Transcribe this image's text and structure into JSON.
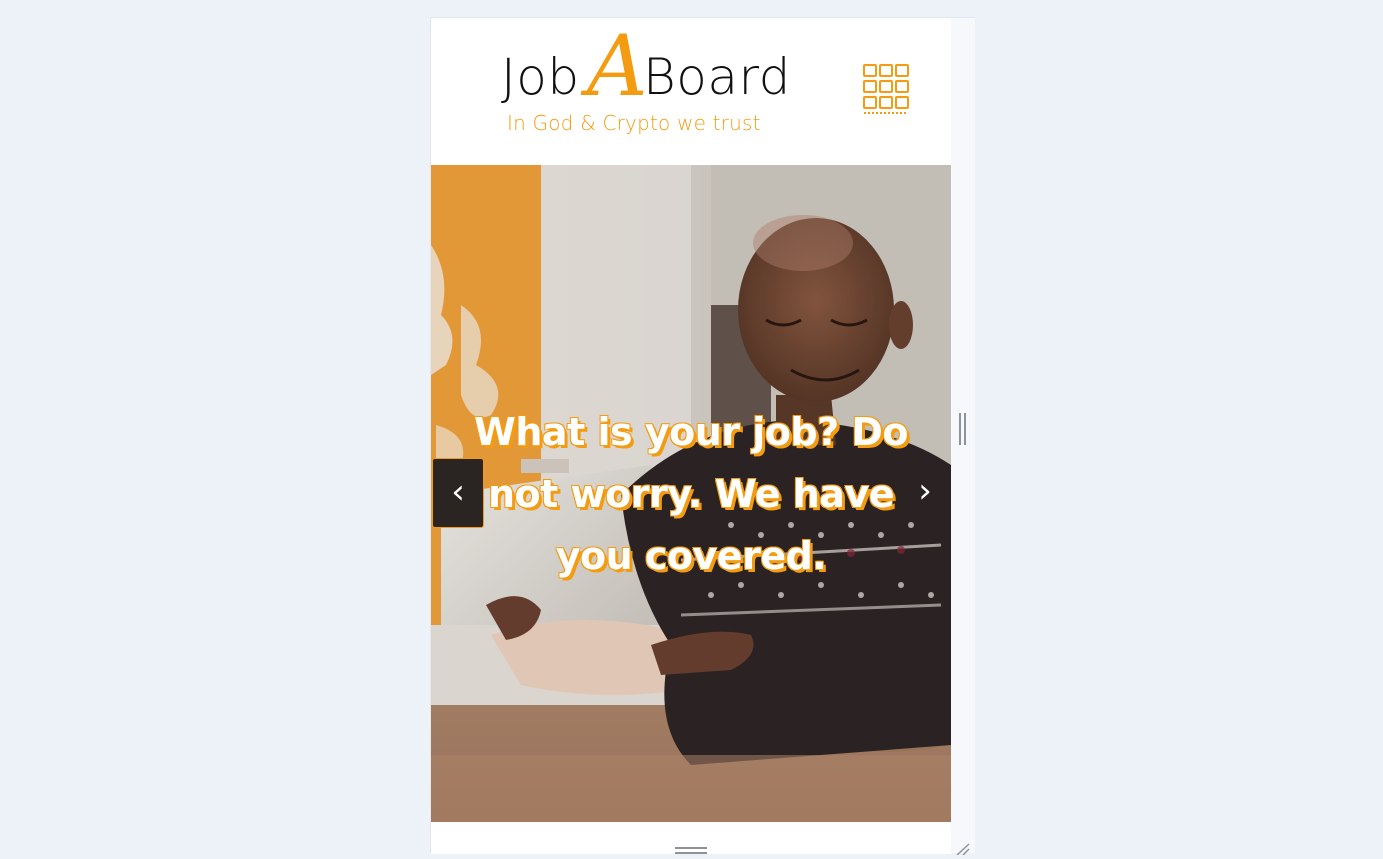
{
  "brand": {
    "name_part1": "Job",
    "name_letter": "A",
    "name_part2": "Board",
    "tagline": "In God & Crypto we trust",
    "accent_color": "#f39c12"
  },
  "header": {
    "menu_icon": "grid-menu-icon"
  },
  "hero": {
    "caption": "What is your job? Do not worry. We have you covered.",
    "prev_label": "‹",
    "next_label": "›"
  }
}
